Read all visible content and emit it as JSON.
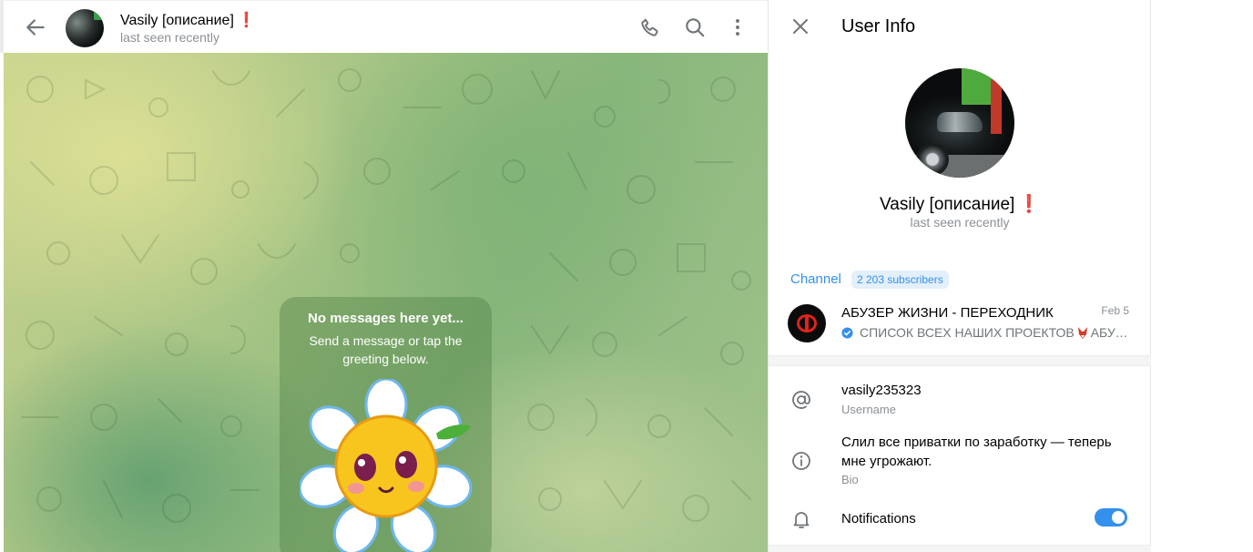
{
  "chat": {
    "name": "Vasily [описание]",
    "alert_mark": "❗",
    "status": "last seen recently",
    "empty_title": "No messages here yet...",
    "empty_subtitle": "Send a message or tap the greeting below.",
    "icons": [
      "back-arrow-icon",
      "phone-icon",
      "search-icon",
      "more-vertical-icon"
    ]
  },
  "info": {
    "title": "User Info",
    "name": "Vasily [описание]",
    "alert_mark": "❗",
    "status": "last seen recently",
    "channel_label": "Channel",
    "subscribers": "2 203 subscribers",
    "channel": {
      "name": "АБУЗЕР ЖИЗНИ - ПЕРЕХОДНИК",
      "date": "Feb 5",
      "preview": "СПИСОК ВСЕХ НАШИХ ПРОЕКТОВ",
      "preview_tail": "АБУЗЕР ЖИЗНИ"
    },
    "username": "vasily235323",
    "username_caption": "Username",
    "bio": "Слил все приватки по заработку — теперь мне угрожают.",
    "bio_caption": "Bio",
    "notifications_label": "Notifications",
    "notifications_on": true
  },
  "colors": {
    "accent": "#3390ec",
    "alert": "#d7263d",
    "secondary_text": "#8b9095"
  }
}
